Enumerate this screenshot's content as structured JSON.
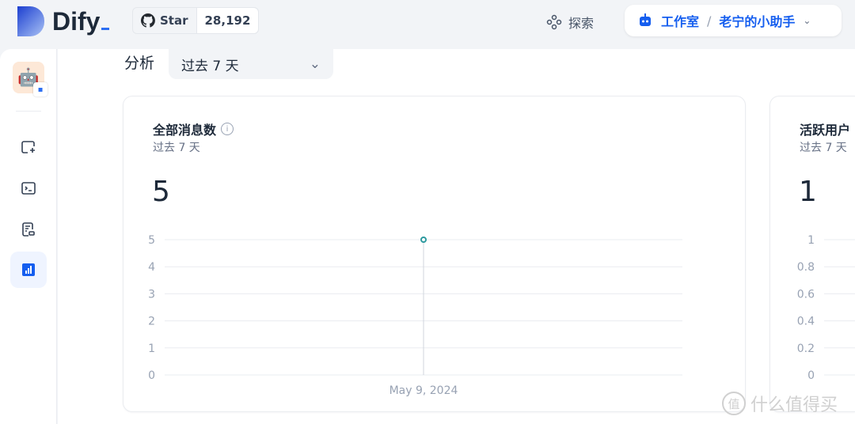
{
  "header": {
    "brand": "Dify",
    "github": {
      "star_label": "Star",
      "count": "28,192"
    },
    "explore_label": "探索",
    "workspace": "工作室",
    "app_name": "老宁的小助手"
  },
  "sidebar": {
    "avatar_emoji": "🤖",
    "items": [
      {
        "name": "orchestrate",
        "icon": "sparkle-window-icon"
      },
      {
        "name": "api",
        "icon": "terminal-icon"
      },
      {
        "name": "logs",
        "icon": "document-icon"
      },
      {
        "name": "overview",
        "icon": "bar-chart-icon",
        "active": true
      }
    ]
  },
  "toolbar": {
    "label": "分析",
    "period": "过去 7 天"
  },
  "cards": [
    {
      "title": "全部消息数",
      "subtitle": "过去 7 天",
      "value": "5"
    },
    {
      "title": "活跃用户",
      "subtitle": "过去 7 天",
      "value": "1"
    }
  ],
  "chart_data": [
    {
      "type": "line",
      "categories": [
        "May 9, 2024"
      ],
      "values": [
        5
      ],
      "yticks": [
        "0",
        "1",
        "2",
        "3",
        "4",
        "5"
      ],
      "ylim": [
        0,
        5
      ],
      "grid": true,
      "color": "#2e9a9f"
    },
    {
      "type": "line",
      "yticks": [
        "0",
        "0.2",
        "0.4",
        "0.6",
        "0.8",
        "1"
      ],
      "ylim": [
        0,
        1
      ],
      "grid": true
    }
  ],
  "watermark": "什么值得买",
  "watermark_badge": "值"
}
